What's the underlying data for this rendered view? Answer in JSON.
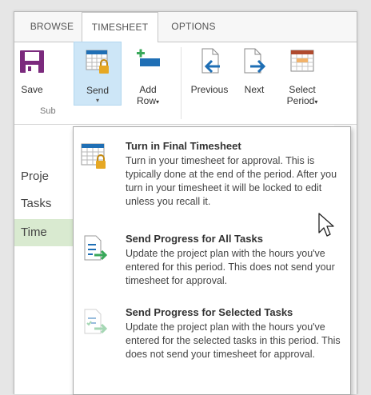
{
  "tabs": [
    {
      "label": "BROWSE",
      "active": false
    },
    {
      "label": "TIMESHEET",
      "active": true
    },
    {
      "label": "OPTIONS",
      "active": false
    }
  ],
  "ribbon": {
    "save_label": "Save",
    "send_label": "Send",
    "add_row_label_1": "Add",
    "add_row_label_2": "Row",
    "previous_label": "Previous",
    "next_label": "Next",
    "select_period_label_1": "Select",
    "select_period_label_2": "Period",
    "group_label": "Sub",
    "caret": "▾"
  },
  "nav": {
    "items": [
      {
        "label": "Proje"
      },
      {
        "label": "Tasks"
      },
      {
        "label": "Time"
      }
    ]
  },
  "menu": {
    "items": [
      {
        "title": "Turn in Final Timesheet",
        "description": "Turn in your timesheet for approval. This is typically done at the end of the period. After you turn in your timesheet it will be locked to edit unless you recall it."
      },
      {
        "title": "Send Progress for All Tasks",
        "description": "Update the project plan with the hours you've entered for this period. This does not send your timesheet for approval."
      },
      {
        "title": "Send Progress for Selected Tasks",
        "description": "Update the project plan with the hours you've entered for the selected tasks in this period. This does not send your timesheet for approval."
      }
    ]
  },
  "colors": {
    "accent_purple": "#7b2a7d",
    "accent_blue": "#1f6fb5",
    "lock_gold": "#e6a824",
    "add_green": "#39a85a",
    "selected_bg": "#cde6f7",
    "nav_selected_bg": "#d9ead0"
  }
}
